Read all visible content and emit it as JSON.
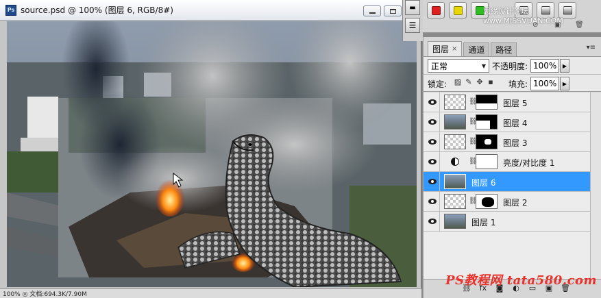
{
  "document": {
    "title": "source.psd @ 100% (图层 6, RGB/8#)",
    "icon": "photoshop-doc-icon",
    "status": "100% ◎   文档:694.3K/7.90M"
  },
  "watermark_top": "思缘设计论坛 www.MISSVUAN.COM",
  "watermark_bottom": "PS教程网 tata580.com",
  "panel_tabs": [
    {
      "label": "图层",
      "close": "×"
    },
    {
      "label": "通道"
    },
    {
      "label": "路径"
    }
  ],
  "blend_mode": "正常",
  "opacity_label": "不透明度:",
  "opacity_value": "100%",
  "lock_label": "锁定:",
  "fill_label": "填充:",
  "fill_value": "100%",
  "layers": [
    {
      "name": "图层 5",
      "selected": false
    },
    {
      "name": "图层 4",
      "selected": false
    },
    {
      "name": "图层 3",
      "selected": false
    },
    {
      "name": "亮度/对比度 1",
      "selected": false
    },
    {
      "name": "图层 6",
      "selected": true
    },
    {
      "name": "图层 2",
      "selected": false
    },
    {
      "name": "图层 1",
      "selected": false
    }
  ],
  "colors": {
    "selection": "#3399ff",
    "action_red": "#e02020",
    "action_yellow": "#e8d800",
    "action_green": "#2ec020",
    "watermark_red": "#e8322a"
  }
}
